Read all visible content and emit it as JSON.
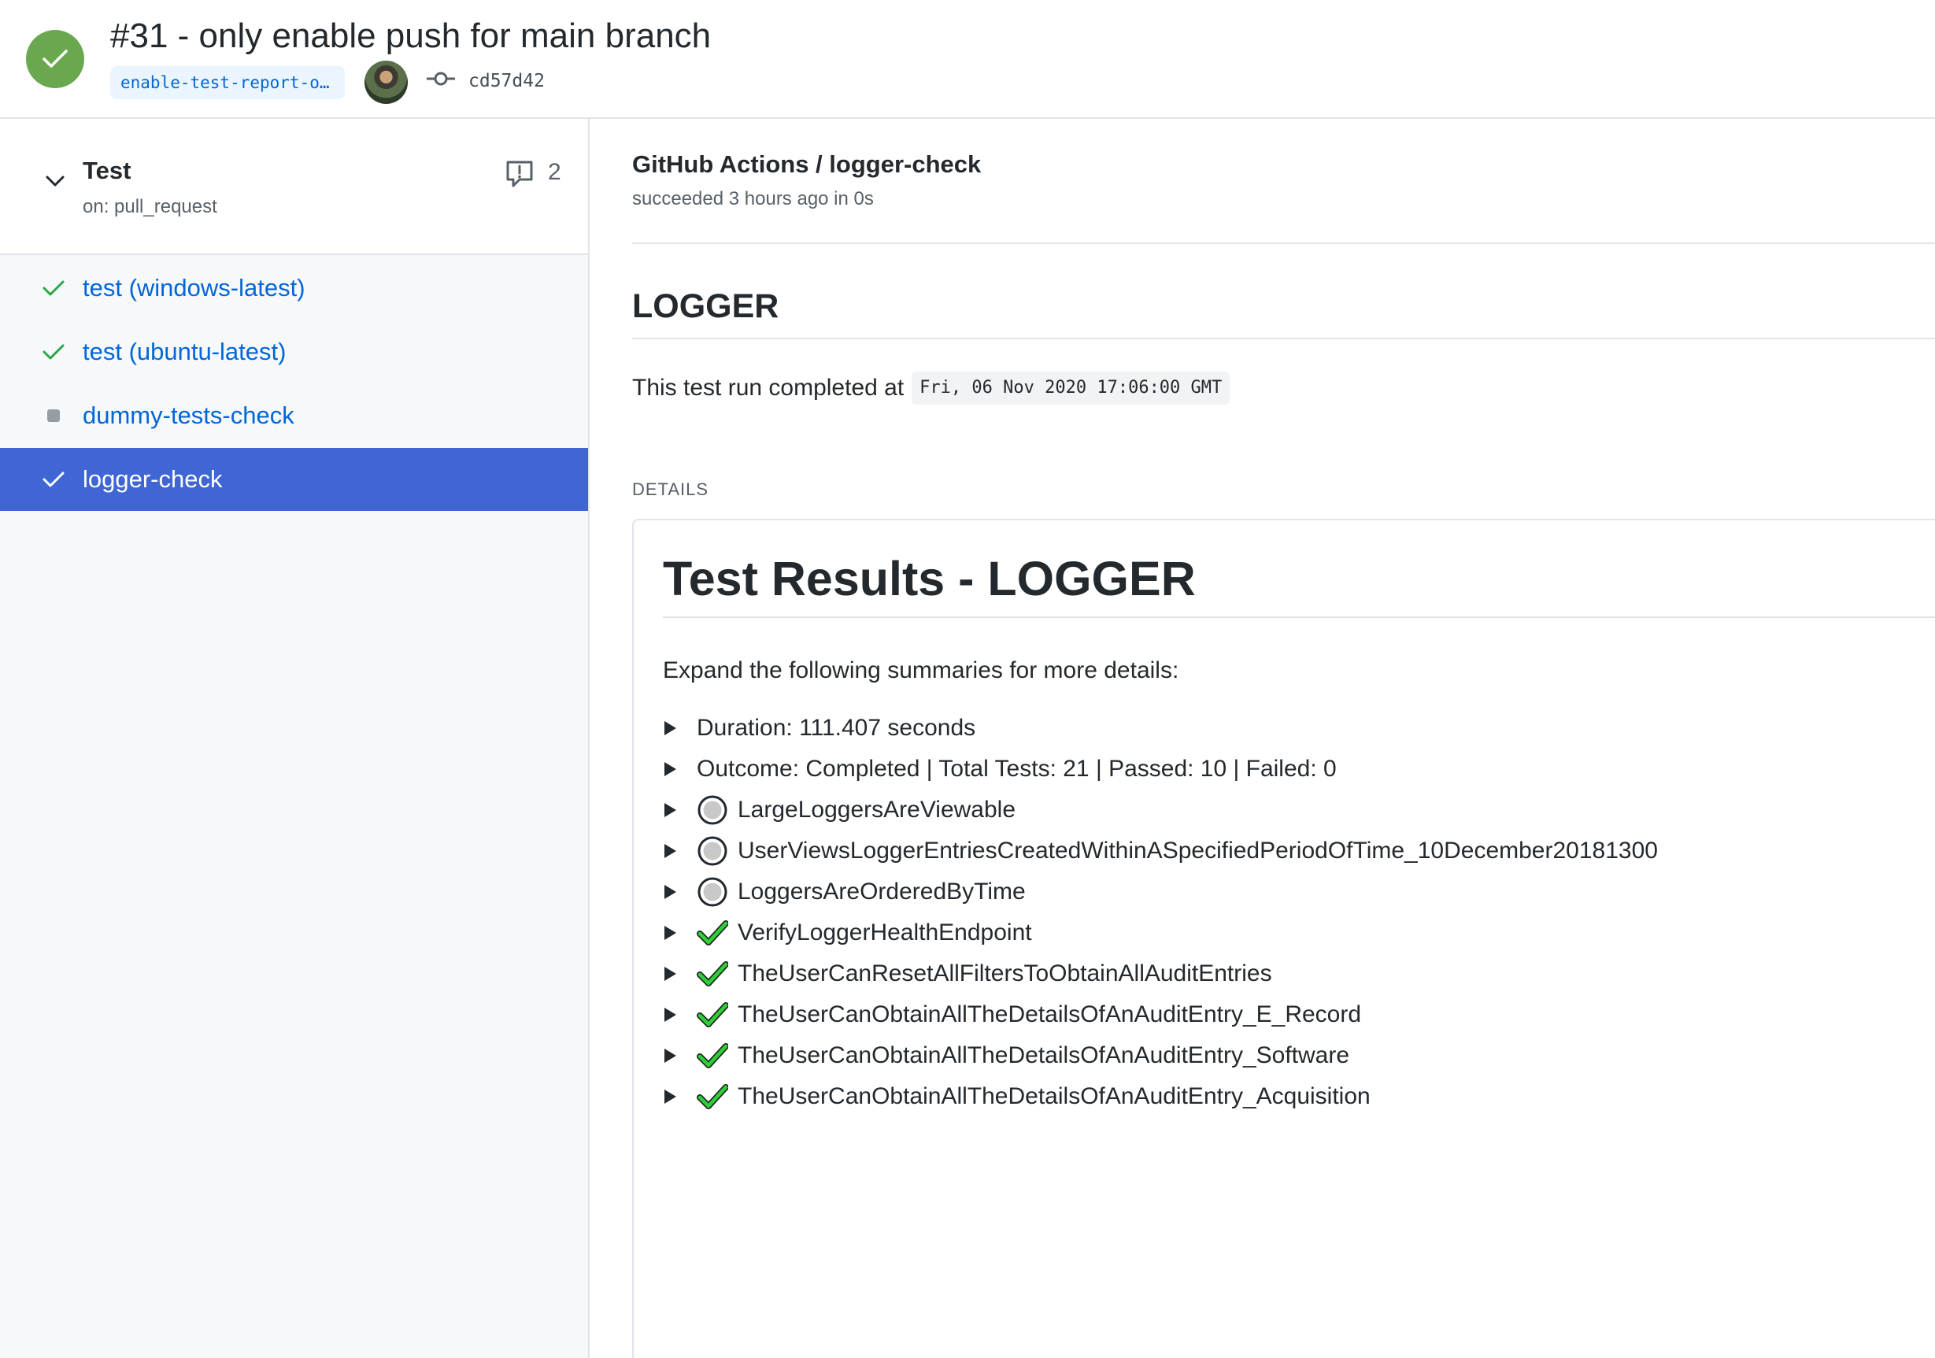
{
  "header": {
    "run_title": "#31 - only enable push for main branch",
    "branch": "enable-test-report-o…",
    "commit_sha": "cd57d42",
    "status_color": "#6aa84f"
  },
  "sidebar": {
    "workflow_name": "Test",
    "workflow_trigger": "on: pull_request",
    "annotations_count": "2",
    "jobs": [
      {
        "label": "test (windows-latest)",
        "status": "success"
      },
      {
        "label": "test (ubuntu-latest)",
        "status": "success"
      },
      {
        "label": "dummy-tests-check",
        "status": "skipped"
      },
      {
        "label": "logger-check",
        "status": "success",
        "selected": true
      }
    ],
    "selected_color": "#3f66d4"
  },
  "main": {
    "check_app": "GitHub Actions / logger-check",
    "check_status": "succeeded 3 hours ago in 0s",
    "summary_title": "LOGGER",
    "completed_prefix": "This test run completed at",
    "completed_time": "Fri, 06 Nov 2020 17:06:00 GMT",
    "details_label": "DETAILS",
    "report": {
      "title": "Test Results - LOGGER",
      "intro": "Expand the following summaries for more details:",
      "rows": [
        {
          "text": "Duration: 111.407 seconds",
          "icon": "none"
        },
        {
          "text": "Outcome: Completed | Total Tests: 21 | Passed: 10 | Failed: 0",
          "icon": "none"
        },
        {
          "text": "LargeLoggersAreViewable",
          "icon": "skipped-circle-icon"
        },
        {
          "text": "UserViewsLoggerEntriesCreatedWithinASpecifiedPeriodOfTime_10December20181300",
          "icon": "skipped-circle-icon"
        },
        {
          "text": "LoggersAreOrderedByTime",
          "icon": "skipped-circle-icon"
        },
        {
          "text": "VerifyLoggerHealthEndpoint",
          "icon": "pass-check-icon"
        },
        {
          "text": "TheUserCanResetAllFiltersToObtainAllAuditEntries",
          "icon": "pass-check-icon"
        },
        {
          "text": "TheUserCanObtainAllTheDetailsOfAnAuditEntry_E_Record",
          "icon": "pass-check-icon"
        },
        {
          "text": "TheUserCanObtainAllTheDetailsOfAnAuditEntry_Software",
          "icon": "pass-check-icon"
        },
        {
          "text": "TheUserCanObtainAllTheDetailsOfAnAuditEntry_Acquisition",
          "icon": "pass-check-icon"
        }
      ]
    }
  }
}
